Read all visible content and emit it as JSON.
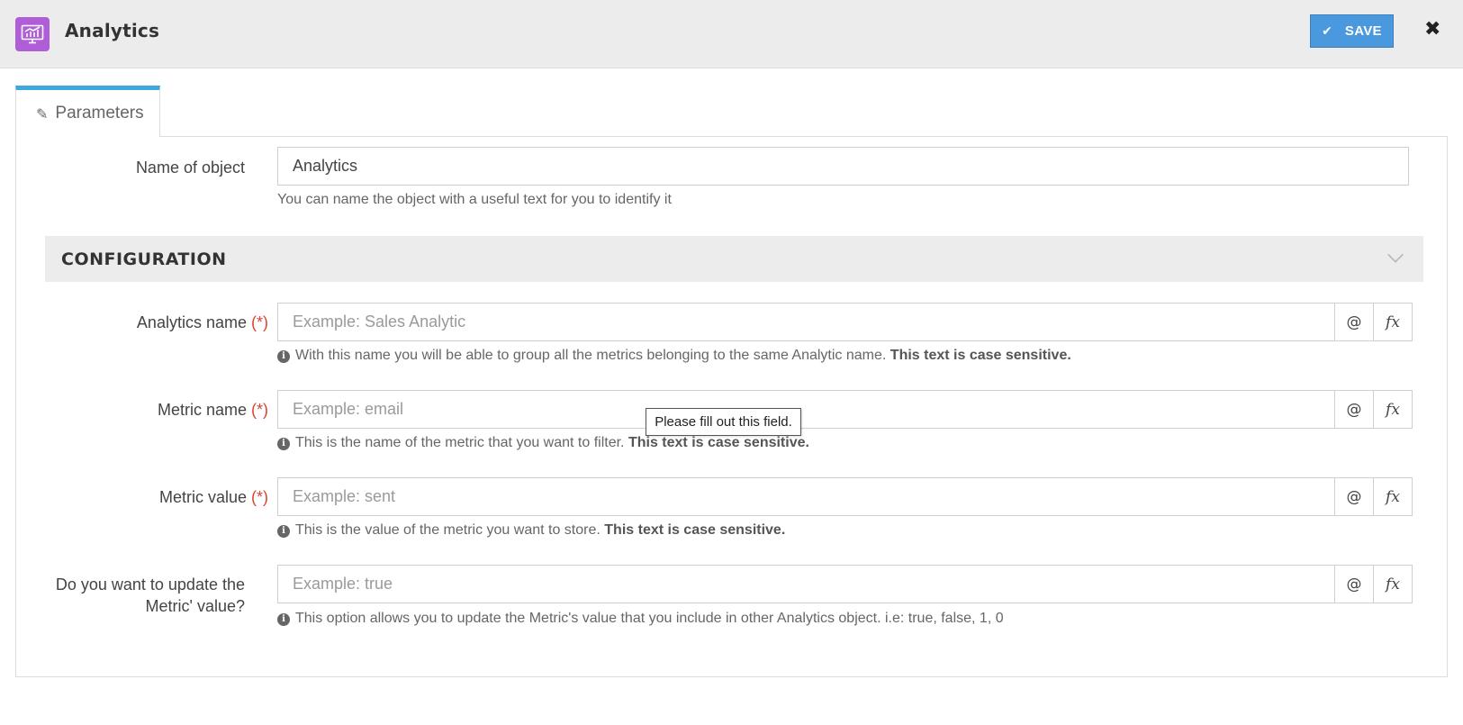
{
  "header": {
    "app_icon": "analytics-monitor-icon",
    "title": "Analytics",
    "save_icon": "check-icon",
    "save_label": "SAVE",
    "close_icon": "close-icon",
    "colors": {
      "accent": "#4a99de",
      "app_icon_bg": "#b05dd8",
      "tab_accent": "#3fa7df",
      "required": "#d9442f"
    }
  },
  "tabs": [
    {
      "label": "Parameters",
      "icon": "edit-icon",
      "active": true
    }
  ],
  "name_field": {
    "label": "Name of object",
    "value": "Analytics",
    "help": "You can name the object with a useful text for you to identify it"
  },
  "section": {
    "title": "CONFIGURATION",
    "icon": "chevron-down-icon"
  },
  "fields": [
    {
      "label": "Analytics name",
      "required_mark": "(*)",
      "placeholder": "Example: Sales Analytic",
      "value": "",
      "addon_at": "@",
      "addon_fx": "fx",
      "help": "With this name you will be able to group all the metrics belonging to the same Analytic name.",
      "help_bold": "This text is case sensitive."
    },
    {
      "label": "Metric name",
      "required_mark": "(*)",
      "placeholder": "Example: email",
      "value": "",
      "addon_at": "@",
      "addon_fx": "fx",
      "help": "This is the name of the metric that you want to filter.",
      "help_bold": "This text is case sensitive."
    },
    {
      "label": "Metric value",
      "required_mark": "(*)",
      "placeholder": "Example: sent",
      "value": "",
      "addon_at": "@",
      "addon_fx": "fx",
      "help": "This is the value of the metric you want to store.",
      "help_bold": "This text is case sensitive."
    },
    {
      "label_line1": "Do you want to update the",
      "label_line2": "Metric' value?",
      "placeholder": "Example: true",
      "value": "",
      "addon_at": "@",
      "addon_fx": "fx",
      "help": "This option allows you to update the Metric's value that you include in other Analytics object. i.e: true, false, 1, 0"
    }
  ],
  "validation_tooltip": "Please fill out this field."
}
